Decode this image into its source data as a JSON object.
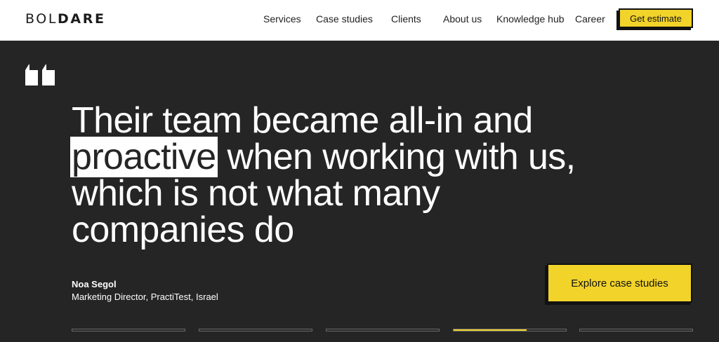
{
  "brand": {
    "logo_light": "BOL",
    "logo_bold": "DARE"
  },
  "nav": {
    "items": [
      {
        "label": "Services"
      },
      {
        "label": "Case studies"
      },
      {
        "label": "Clients"
      },
      {
        "label": "About us"
      },
      {
        "label": "Knowledge hub"
      },
      {
        "label": "Career"
      }
    ],
    "cta_label": "Get estimate"
  },
  "testimonial": {
    "quote_lines": [
      "Their team became all-in and",
      "proactive",
      " when working with us,",
      "which is not what many",
      "companies do"
    ],
    "author_name": "Noa Segol",
    "author_role": "Marketing Director, PractiTest, Israel"
  },
  "hero_cta_label": "Explore case studies",
  "slider": {
    "count": 5,
    "active_index": 3,
    "active_progress": 0.65
  },
  "colors": {
    "accent": "#f1d32a",
    "background": "#252525",
    "text": "#ffffff"
  },
  "icons": {
    "quote": "quote-icon"
  }
}
